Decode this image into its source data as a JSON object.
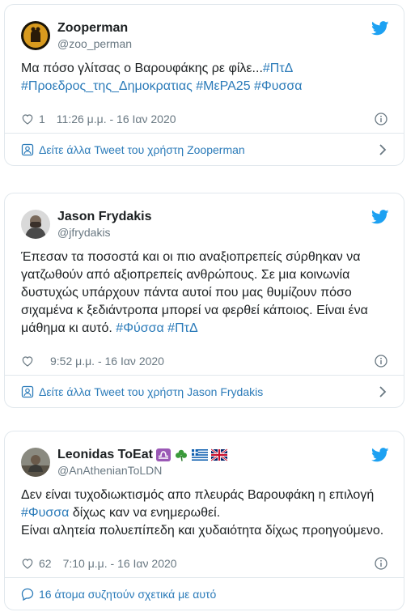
{
  "tweets": [
    {
      "name": "Zooperman",
      "handle": "@zoo_perman",
      "text_parts": [
        "Μα πόσο γλίτσας ο Βαρουφάκης ρε φίλε...",
        "#ΠτΔ",
        " ",
        "#Προεδρος_της_Δημοκρατιας",
        " ",
        "#ΜεΡΑ25",
        " ",
        "#Φυσσα"
      ],
      "likes": "1",
      "time": "11:26 μ.μ. - 16 Ιαν 2020",
      "footer": "Δείτε άλλα Tweet του χρήστη Zooperman"
    },
    {
      "name": "Jason Frydakis",
      "handle": "@jfrydakis",
      "text_parts": [
        "Έπεσαν τα ποσοστά και οι πιο αναξιοπρεπείς σύρθηκαν να γατζωθούν από αξιοπρεπείς ανθρώπους. Σε μια κοινωνία δυστυχώς υπάρχουν πάντα αυτοί που μας θυμίζουν πόσο σιχαμένα κ ξεδιάντροπα μπορεί να φερθεί  κάποιος. Είναι ένα μάθημα κι αυτό. ",
        "#Φύσσα",
        " ",
        "#ΠτΔ"
      ],
      "likes": "",
      "time": "9:52 μ.μ. - 16 Ιαν 2020",
      "footer": "Δείτε άλλα Tweet του χρήστη Jason Frydakis"
    },
    {
      "name": "Leonidas ToEat",
      "handle": "@AnAthenianToLDN",
      "text_parts": [
        "Δεν είναι τυχοδιωκτισμός απο πλευράς Βαρουφάκη η επιλογή ",
        "#Φυσσα",
        " δίχως καν να ενημερωθεί.\nΕίναι αλητεία πολυεπίπεδη και χυδαιότητα δίχως προηγούμενο."
      ],
      "likes": "62",
      "time": "7:10 μ.μ. - 16 Ιαν 2020",
      "footer": "16 άτομα συζητούν σχετικά με αυτό"
    }
  ],
  "colors": {
    "link": "#2b7bb9",
    "meta": "#697882",
    "text": "#1c2022",
    "border": "#e1e8ed",
    "bird": "#1da1f2"
  },
  "icons": [
    "twitter-bird-icon",
    "heart-icon",
    "info-icon",
    "profile-icon",
    "comment-icon",
    "chevron-right-icon",
    "libra-emoji",
    "shamrock-emoji",
    "greece-flag-emoji",
    "uk-flag-emoji"
  ]
}
